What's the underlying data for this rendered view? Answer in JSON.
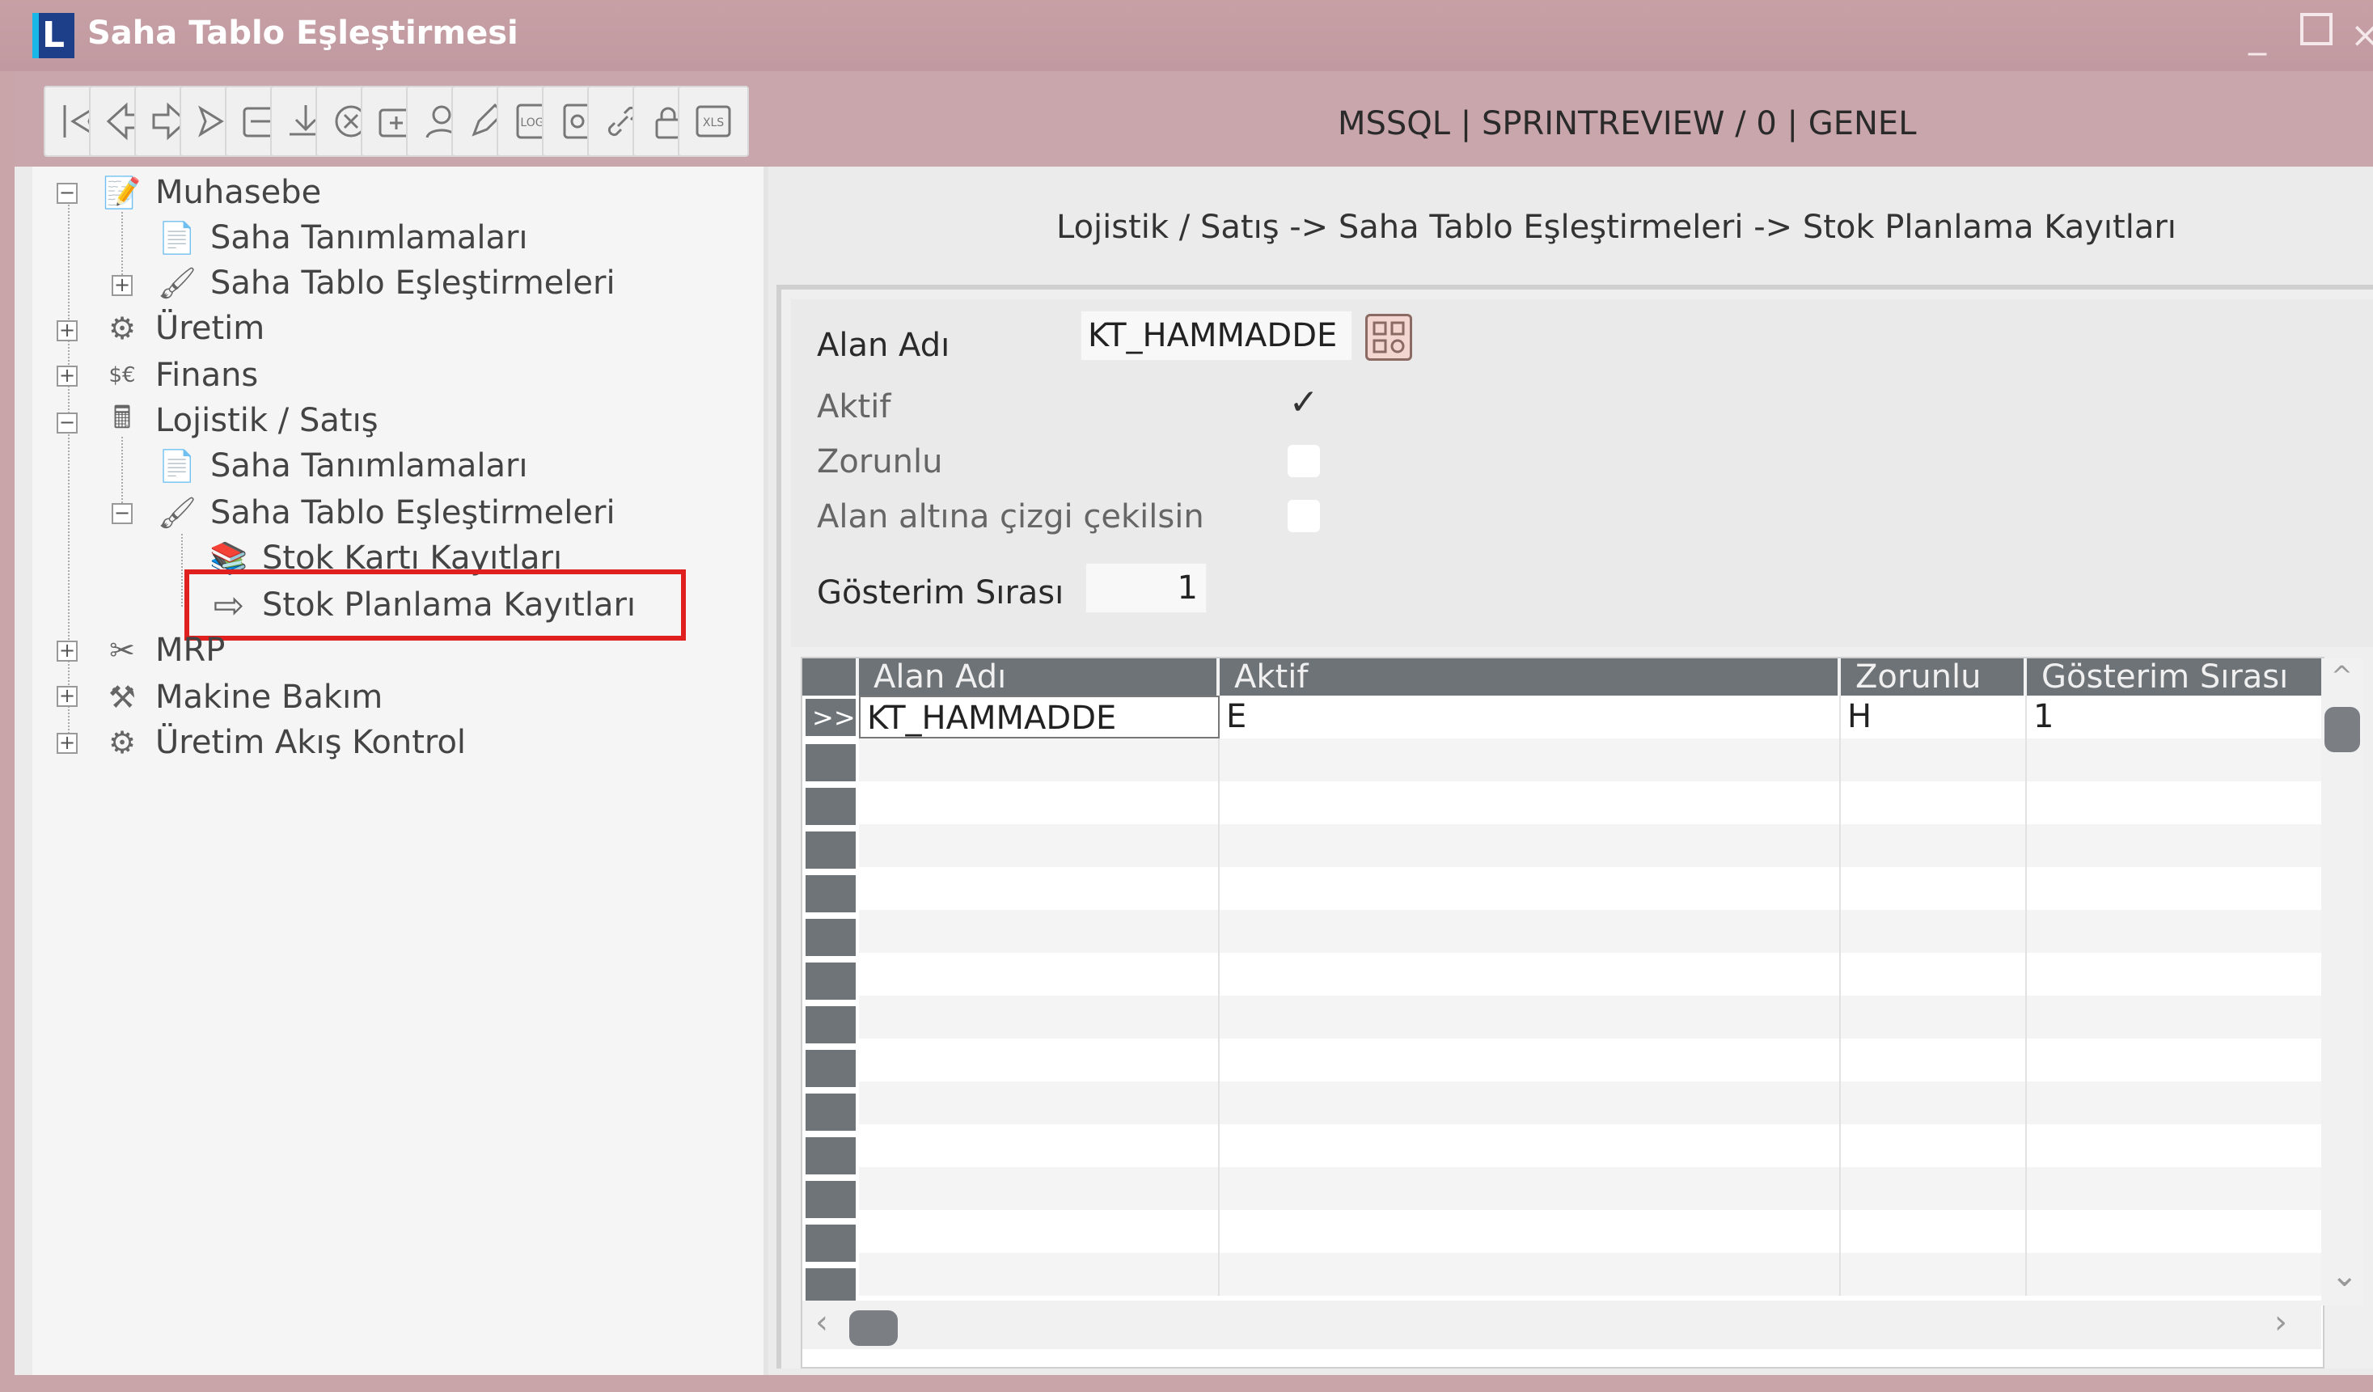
{
  "window": {
    "title": "Saha Tablo Eşleştirmesi",
    "logo_letter": "L",
    "minimize": "_",
    "close": "×"
  },
  "toolbar": {
    "buttons": [
      {
        "name": "first-record-icon"
      },
      {
        "name": "previous-record-icon"
      },
      {
        "name": "next-record-icon"
      },
      {
        "name": "last-record-icon"
      },
      {
        "name": "save-icon"
      },
      {
        "name": "download-icon"
      },
      {
        "name": "delete-icon"
      },
      {
        "name": "add-folder-icon"
      },
      {
        "name": "user-icon"
      },
      {
        "name": "edit-pencil-icon"
      },
      {
        "name": "log-icon"
      },
      {
        "name": "document-icon"
      },
      {
        "name": "link-icon"
      },
      {
        "name": "lock-icon"
      },
      {
        "name": "xls-export-icon"
      }
    ],
    "log_label": "LOG",
    "xls_label": "XLS",
    "connection_info": "MSSQL | SPRINTREVIEW / 0 | GENEL"
  },
  "tree": {
    "items": [
      {
        "label": "Muhasebe",
        "icon": "ledger-icon",
        "glyph": "📝"
      },
      {
        "label": "Saha Tanımlamaları",
        "icon": "field-definition-icon",
        "glyph": "📄"
      },
      {
        "label": "Saha Tablo Eşleştirmeleri",
        "icon": "brush-icon",
        "glyph": "🖌"
      },
      {
        "label": "Üretim",
        "icon": "production-icon",
        "glyph": "⚙"
      },
      {
        "label": "Finans",
        "icon": "finance-icon",
        "glyph": "$€"
      },
      {
        "label": "Lojistik / Satış",
        "icon": "calculator-icon",
        "glyph": "🖩"
      },
      {
        "label": "Saha Tanımlamaları",
        "icon": "field-definition-icon",
        "glyph": "📄"
      },
      {
        "label": "Saha Tablo Eşleştirmeleri",
        "icon": "brush-icon",
        "glyph": "🖌"
      },
      {
        "label": "Stok Kartı Kayıtları",
        "icon": "stock-card-icon",
        "glyph": "📚"
      },
      {
        "label": "Stok Planlama Kayıtları",
        "icon": "arrow-right-icon",
        "glyph": "⇨"
      },
      {
        "label": "MRP",
        "icon": "tools-icon",
        "glyph": "✂"
      },
      {
        "label": "Makine Bakım",
        "icon": "maintenance-icon",
        "glyph": "⚒"
      },
      {
        "label": "Üretim Akış Kontrol",
        "icon": "flow-control-icon",
        "glyph": "⚙"
      }
    ],
    "expander_minus": "−",
    "expander_plus": "+"
  },
  "breadcrumb": "Lojistik / Satış -> Saha Tablo Eşleştirmeleri -> Stok Planlama Kayıtları",
  "form": {
    "alan_adi_label": "Alan Adı",
    "alan_adi_value": "KT_HAMMADDE",
    "aktif_label": "Aktif",
    "aktif_checked": true,
    "aktif_mark": "✓",
    "zorunlu_label": "Zorunlu",
    "zorunlu_checked": false,
    "alt_cizgi_label": "Alan altına çizgi çekilsin",
    "alt_cizgi_checked": false,
    "gosterim_label": "Gösterim Sırası",
    "gosterim_value": "1"
  },
  "grid": {
    "columns": [
      "Alan Adı",
      "Aktif",
      "Zorunlu",
      "Gösterim Sırası"
    ],
    "rows": [
      {
        "indicator": ">>",
        "alan_adi": "KT_HAMMADDE",
        "aktif": "E",
        "zorunlu": "H",
        "gosterim": "1"
      }
    ],
    "scroll_left": "‹",
    "scroll_right": "›",
    "scroll_up": "^",
    "scroll_down": "⌄"
  },
  "colors": {
    "titlebar": "#c7a0a6",
    "highlight": "#e01f1f",
    "grid_header": "#6e7378"
  }
}
